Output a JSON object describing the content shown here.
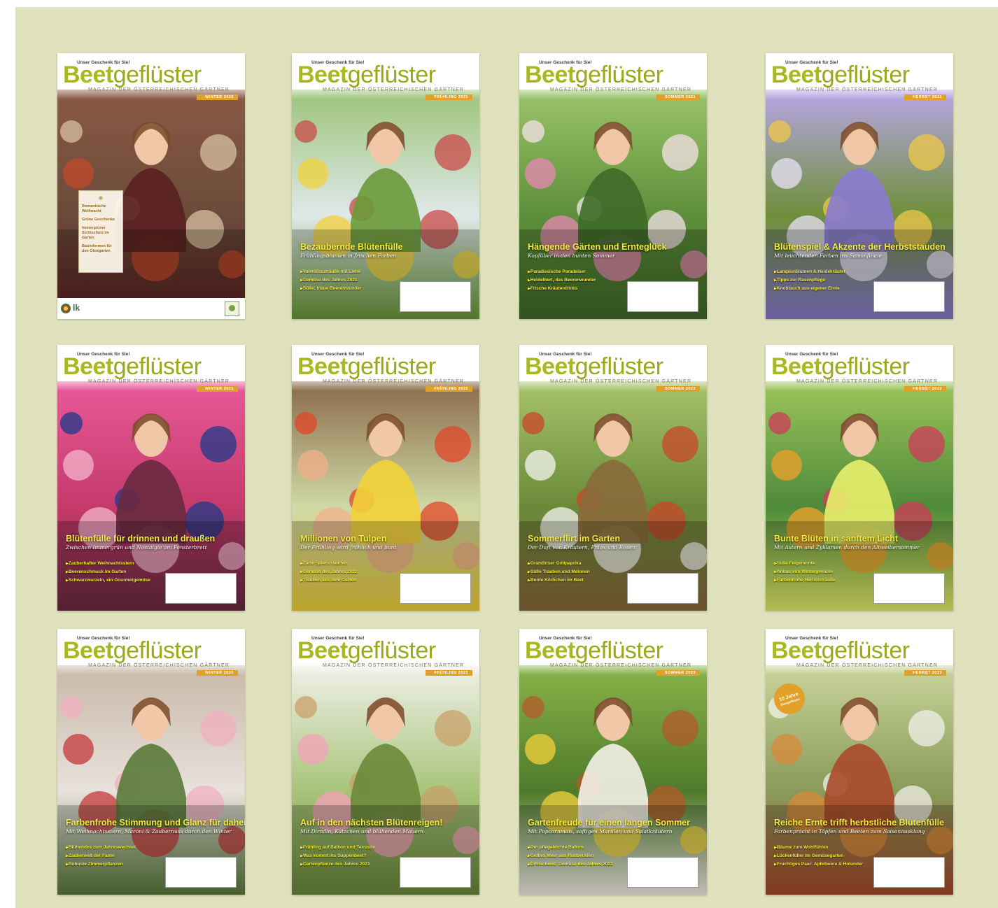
{
  "panel": {
    "background": "#dfe2bc"
  },
  "brand": {
    "gift": "Unser Geschenk für Sie!",
    "part1": "Beet",
    "part2": "geflüster",
    "subtitle": "MAGAZIN DER ÖSTERREICHISCHEN GÄRTNER"
  },
  "covers": [
    {
      "season": "WINTER 2020",
      "headline": "",
      "sub": "",
      "toc": [
        "Romantische Weihnacht",
        "Grüne Geschenke",
        "Immergrüner Sichtschutz im Garten",
        "Baumformen für den Obstgarten"
      ],
      "footer_logo": "lk",
      "theme": "winter1"
    },
    {
      "season": "FRÜHLING 2021",
      "headline": "Bezaubernde Blütenfülle",
      "sub": "Frühlingsblumen in frischen Farben",
      "bullets": [
        "Valentinssträuße mit Liebe",
        "Gemüse des Jahres 2021",
        "Süße, blaue Beerenwunder"
      ],
      "theme": "spring1"
    },
    {
      "season": "SOMMER 2021",
      "headline": "Hängende Gärten und Ernteglück",
      "sub": "Kopfüber in den bunten Sommer",
      "bullets": [
        "Paradiesische Paradeiser",
        "Heidelbert, das Beerenwunder",
        "Frische Kräuterdrinks"
      ],
      "theme": "summer1"
    },
    {
      "season": "HERBST 2021",
      "headline": "Blütenspiel & Akzente der Herbststauden",
      "sub": "Mit leuchtenden Farben ins Saisonfinale",
      "bullets": [
        "Lampionblumen & Heidekräuter",
        "Tipps zur Rasenpflege",
        "Knoblauch aus eigener Ernte"
      ],
      "theme": "autumn1"
    },
    {
      "season": "WINTER 2021",
      "headline": "Blütenfülle für drinnen und draußen",
      "sub": "Zwischen Immergrün und Nostalgie am Fensterbrett",
      "bullets": [
        "Zauberhafter Weihnachtsstern",
        "Beerenschmuck im Garten",
        "Schwarzwurzeln, ein Gourmetgemüse"
      ],
      "theme": "winter2"
    },
    {
      "season": "FRÜHLING 2022",
      "headline": "Millionen von Tulpen",
      "sub": "Der Frühling wird fröhlich und bunt",
      "bullets": [
        "Zarte Spiersträucher",
        "Gemüse des Jahres 2022",
        "Trauben aus dem Garten"
      ],
      "theme": "spring2"
    },
    {
      "season": "SOMMER 2022",
      "headline": "Sommerflirt im Garten",
      "sub": "Der Duft von Kräutern, Phlox und Rosen",
      "bullets": [
        "Grandioser Grillpaprika",
        "Süße Trauben und Melonen",
        "Bunte Körbchen im Beet"
      ],
      "theme": "summer2"
    },
    {
      "season": "HERBST 2022",
      "headline": "Bunte Blüten in sanftem Licht",
      "sub": "Mit Astern und Zyklamen durch den Altweibersommer",
      "bullets": [
        "Süße Feigenernte",
        "Anbau von Wintergemüse",
        "Farbenfrohe Herbststräuße"
      ],
      "theme": "autumn2"
    },
    {
      "season": "WINTER 2022",
      "headline": "Farbenfrohe Stimmung und Glanz für daheim",
      "sub": "Mit Weihnachtsstern, Maroni & Zaubernuss durch den Winter",
      "bullets": [
        "Blühendes zum Jahreswechsel",
        "Zauberwelt der Farne",
        "Robuste Zimmerpflanzen"
      ],
      "theme": "winter3"
    },
    {
      "season": "FRÜHLING 2023",
      "headline": "Auf in den nächsten Blütenreigen!",
      "sub": "Mit Dirndln, Kätzchen und blühenden Mauern",
      "bullets": [
        "Frühling auf Balkon und Terrasse",
        "Was kommt ins Suppenbeet?",
        "Gartenpflanze des Jahres 2023"
      ],
      "theme": "spring3"
    },
    {
      "season": "SOMMER 2023",
      "headline": "Gartenfreude für einen langen Sommer",
      "sub": "Mit Popcornmais, saftigen Marillen und Salatkräutern",
      "bullets": [
        "Der pflegeleichte Balkon",
        "Gelbes Meer aus Rudbeckien",
        "Erfrischend: Gemüse des Jahres 2023"
      ],
      "theme": "summer3"
    },
    {
      "season": "HERBST 2023",
      "headline": "Reiche Ernte trifft herbstliche Blütenfülle",
      "sub": "Farbenpracht in Töpfen und Beeten zum Saisonausklang",
      "bullets": [
        "Bäume zum Wohlfühlen",
        "Lückenfüller im Gemüsegarten",
        "Fruchtiges Paar: Apfelbeere & Holunder"
      ],
      "badge": "10 Jahre",
      "badge_sub": "Beetgeflüster",
      "theme": "autumn3"
    }
  ]
}
